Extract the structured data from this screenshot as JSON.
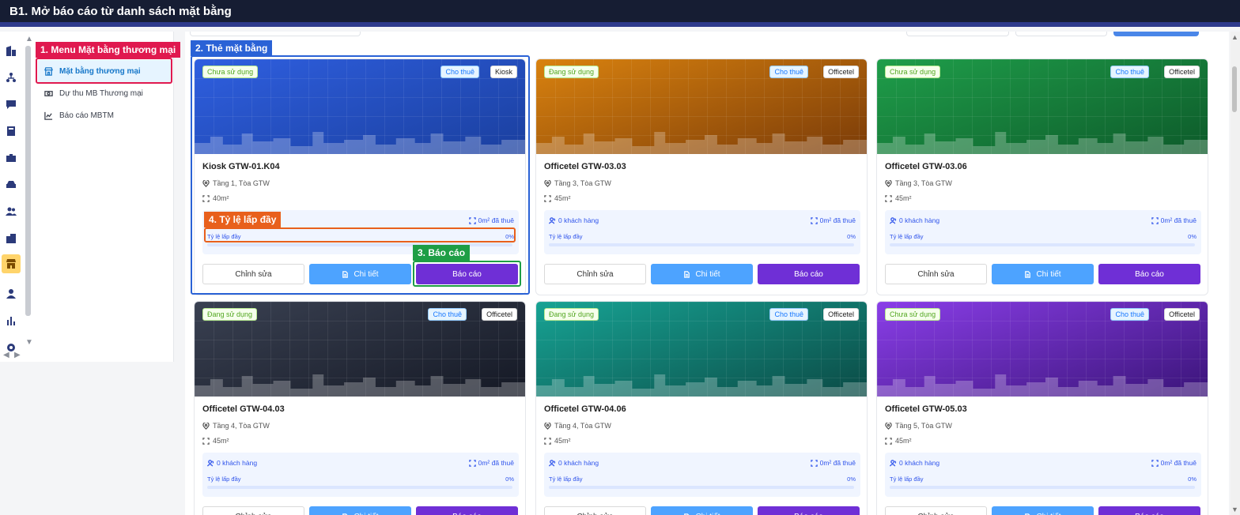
{
  "header": {
    "title": "B1. Mở báo cáo từ danh sách mặt bằng"
  },
  "rail_icons": [
    "building-icon",
    "network-icon",
    "chat-icon",
    "calculator-icon",
    "briefcase-icon",
    "car-icon",
    "users-icon",
    "office-icon",
    "store-icon",
    "person-icon",
    "chart-icon",
    "gear-icon"
  ],
  "sidebar": {
    "items": [
      {
        "label": "Mặt bằng thương mại",
        "icon": "store-icon",
        "active": true
      },
      {
        "label": "Dự thu MB Thương mại",
        "icon": "money-icon",
        "active": false
      },
      {
        "label": "Báo cáo MBTM",
        "icon": "line-chart-icon",
        "active": false
      }
    ]
  },
  "annotations": {
    "menu": "1. Menu Mặt bằng thương mại",
    "card": "2. Thẻ mặt bằng",
    "report": "3. Báo cáo",
    "fill": "4. Tỷ lệ lấp đầy",
    "colors": {
      "menu": "#e0194f",
      "card": "#2a62d6",
      "report": "#1e9e45",
      "fill": "#e8601c"
    }
  },
  "card_labels": {
    "edit": "Chỉnh sửa",
    "detail": "Chi tiết",
    "report": "Báo cáo",
    "fill_label": "Tỷ lệ lấp đầy"
  },
  "cards": [
    {
      "name": "Kiosk GTW-01.K04",
      "status": "Chưa sử dụng",
      "rent": "Cho thuê",
      "type": "Kiosk",
      "location": "Tầng 1, Tòa GTW",
      "area": "40m²",
      "customers": "",
      "rented": "0m² đã thuê",
      "fill_pct": "0%",
      "fill_value": 0,
      "gradient": [
        "#2f5fe0",
        "#1a3f9e"
      ]
    },
    {
      "name": "Officetel GTW-03.03",
      "status": "Đang sử dụng",
      "rent": "Cho thuê",
      "type": "Officetel",
      "location": "Tầng 3, Tòa GTW",
      "area": "45m²",
      "customers": "0 khách hàng",
      "rented": "0m² đã thuê",
      "fill_pct": "0%",
      "fill_value": 0,
      "gradient": [
        "#d9820f",
        "#7a3b08"
      ]
    },
    {
      "name": "Officetel GTW-03.06",
      "status": "Chưa sử dụng",
      "rent": "Cho thuê",
      "type": "Officetel",
      "location": "Tầng 3, Tòa GTW",
      "area": "45m²",
      "customers": "0 khách hàng",
      "rented": "0m² đã thuê",
      "fill_pct": "0%",
      "fill_value": 0,
      "gradient": [
        "#1f9e4a",
        "#0d5a2a"
      ]
    },
    {
      "name": "Officetel GTW-04.03",
      "status": "Đang sử dụng",
      "rent": "Cho thuê",
      "type": "Officetel",
      "location": "Tầng 4, Tòa GTW",
      "area": "45m²",
      "customers": "0 khách hàng",
      "rented": "0m² đã thuê",
      "fill_pct": "0%",
      "fill_value": 0,
      "gradient": [
        "#3a4152",
        "#141824"
      ]
    },
    {
      "name": "Officetel GTW-04.06",
      "status": "Đang sử dụng",
      "rent": "Cho thuê",
      "type": "Officetel",
      "location": "Tầng 4, Tòa GTW",
      "area": "45m²",
      "customers": "0 khách hàng",
      "rented": "0m² đã thuê",
      "fill_pct": "0%",
      "fill_value": 0,
      "gradient": [
        "#17a394",
        "#0b4a45"
      ]
    },
    {
      "name": "Officetel GTW-05.03",
      "status": "Chưa sử dụng",
      "rent": "Cho thuê",
      "type": "Officetel",
      "location": "Tầng 5, Tòa GTW",
      "area": "45m²",
      "customers": "0 khách hàng",
      "rented": "0m² đã thuê",
      "fill_pct": "0%",
      "fill_value": 0,
      "gradient": [
        "#8a3ee8",
        "#3a1478"
      ]
    }
  ]
}
